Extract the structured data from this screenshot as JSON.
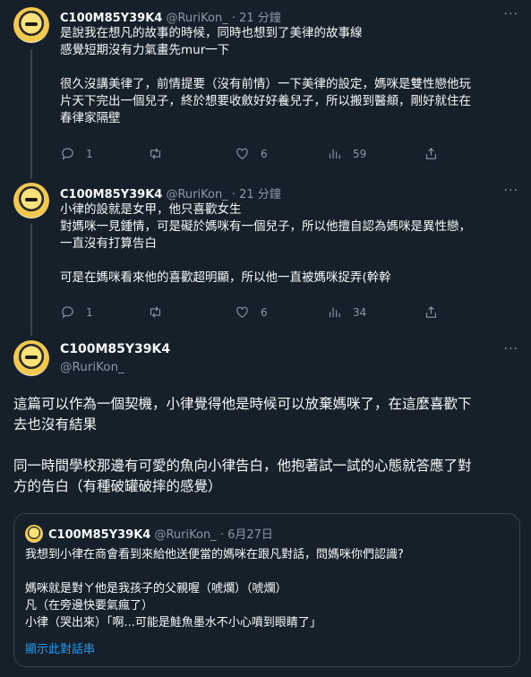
{
  "tweets": [
    {
      "name": "C100M85Y39K4",
      "handle": "@RuriKon_",
      "time": "· 21 分鐘",
      "lines": [
        "是說我在想凡的故事的時候，同時也想到了美律的故事線",
        "感覺短期沒有力氣畫先mur一下",
        "",
        "很久沒講美律了，前情提要（沒有前情）一下美律的設定，媽咪是雙性戀他玩",
        "片天下完出一個兒子，終於想要收斂好好養兒子，所以搬到醫頫，剛好就住在",
        "春律家隔壁"
      ],
      "replies": "1",
      "retweets": "",
      "likes": "6",
      "views": "59"
    },
    {
      "name": "C100M85Y39K4",
      "handle": "@RuriKon_",
      "time": "· 21 分鐘",
      "lines": [
        "小律的設就是女甲，他只喜歡女生",
        "對媽咪一見鍾情，可是礙於媽咪有一個兒子，所以他擅自認為媽咪是異性戀，",
        "一直沒有打算告白",
        "",
        "可是在媽咪看來他的喜歡超明顯，所以他一直被媽咪捉弄(幹幹"
      ],
      "replies": "1",
      "retweets": "",
      "likes": "6",
      "views": "34"
    }
  ],
  "main": {
    "name": "C100M85Y39K4",
    "handle": "@RuriKon_",
    "lines": [
      "這篇可以作為一個契機，小律覺得他是時候可以放棄媽咪了，在這麼喜歡下",
      "去也沒有結果",
      "",
      "同一時間學校那邊有可愛的魚向小律告白，他抱著試一試的心態就答應了對",
      "方的告白（有種破罐破摔的感覺）"
    ]
  },
  "quote": {
    "name": "C100M85Y39K4",
    "handle": "@RuriKon_",
    "date": "· 6月27日",
    "lines": [
      "我想到小律在商會看到來給他送便當的媽咪在跟凡對話，問媽咪你們認識?",
      "",
      "媽咪就是對ㄚ他是我孩子的父親喔（唬爛）（唬爛）",
      "凡（在旁邊快要氣瘋了）",
      "小律（哭出來）「啊...可能是鮭魚墨水不小心噴到眼睛了」"
    ],
    "show_thread": "顯示此對話串"
  },
  "colors": {
    "background": "#15202b",
    "text": "#f7f9f9",
    "secondary": "#8b98a5",
    "link": "#1d9bf0",
    "border": "#38444d"
  },
  "icons": {
    "reply": "reply-icon",
    "retweet": "retweet-icon",
    "like": "heart-icon",
    "views": "views-icon",
    "share": "share-icon",
    "more": "more-icon"
  }
}
